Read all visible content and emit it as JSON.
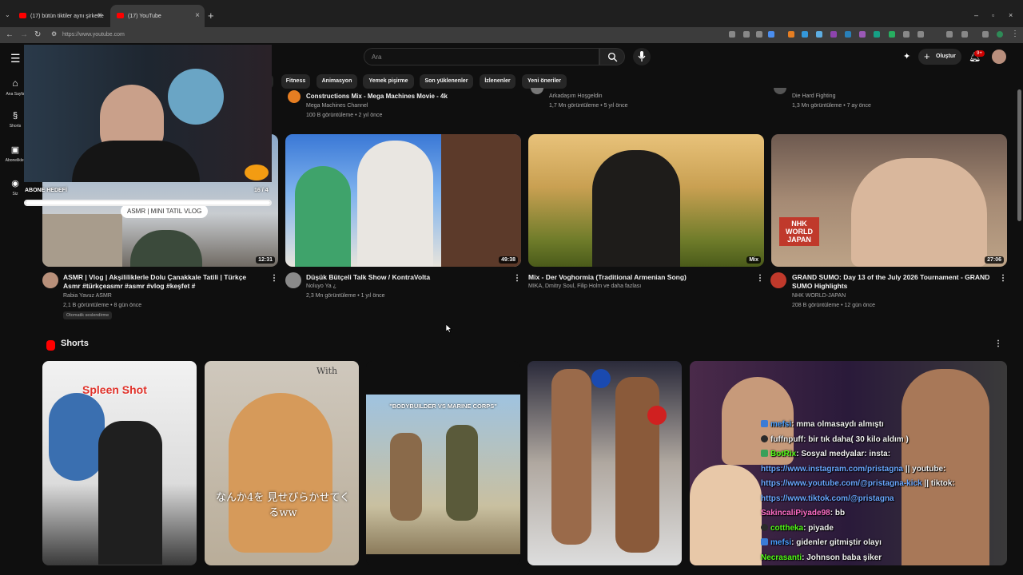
{
  "browser": {
    "tabs": [
      {
        "title": "(17) bütün tiktiler aynı şirkette"
      },
      {
        "title": "(17) YouTube"
      }
    ],
    "url": "https://www.youtube.com"
  },
  "colors": {
    "accent": "#ff0000",
    "background": "#0f0f0f",
    "link": "#3ea6ff"
  },
  "youtube": {
    "search_placeholder": "Ara",
    "create_label": "Oluştur",
    "notification_count": "9+",
    "chips": [
      "Fitness",
      "Animasyon",
      "Yemek pişirme",
      "Son yüklenenler",
      "İzlenenler",
      "Yeni öneriler"
    ],
    "guide": [
      "Ana Sayfa",
      "Shorts",
      "Abonelikler",
      "Siz"
    ],
    "top_row": [
      {
        "title": "Constructions Mix - Mega Machines Movie - 4k",
        "channel": "Mega Machines Channel",
        "meta": "100 B görüntüleme • 2 yıl önce"
      },
      {
        "channel": "Arkadaşım Hoşgeldin",
        "meta": "1,7 Mn görüntüleme • 5 yıl önce"
      },
      {
        "channel": "Die Hard Fighting",
        "meta": "1,3 Mn görüntüleme • 7 ay önce"
      }
    ],
    "videos": [
      {
        "title": "ASMR | Vlog | Akşililiklerle Dolu Çanakkale Tatili | Türkçe Asmr #türkçeasmr #asmr #vlog #keşfet #",
        "channel": "Rabia Yavuz ASMR",
        "meta": "2,1 B görüntüleme • 8 gün önce",
        "duration": "12:31",
        "badge": "Otomatik seslendirme",
        "thumb_text": "ASMR | MINI TATIL VLOG"
      },
      {
        "title": "Düşük Bütçeli Talk Show / KontraVolta",
        "channel": "Noluyo Ya ¿",
        "meta": "2,3 Mn görüntüleme • 1 yıl önce",
        "duration": "49:38"
      },
      {
        "title": "Mix - Der Voghormia (Traditional Armenian Song)",
        "channel": "MIKA, Dmitry Soul, Filip Holm ve daha fazlası",
        "duration": "Mix"
      },
      {
        "title": "GRAND SUMO: Day 13 of the July 2026 Tournament - GRAND SUMO Highlights",
        "channel": "NHK WORLD-JAPAN",
        "meta": "208 B görüntüleme • 12 gün önce",
        "duration": "27:06",
        "thumb_text": "NHK WORLD JAPAN"
      }
    ],
    "shorts_title": "Shorts",
    "shorts": [
      {
        "thumb_text": "Spleen Shot"
      },
      {
        "thumb_text": "なんか4を 見せびらかせてくるww",
        "thumb_text2": "With"
      },
      {
        "thumb_text": "\"BODYBUILDER VS MARINE CORPS\""
      },
      {},
      {}
    ]
  },
  "overlay": {
    "goal_label": "ABONE HEDEFİ",
    "goal_count": "16 / 4",
    "goal_progress": 1.0,
    "chat": [
      {
        "user": "mefsi",
        "msg": ": mma olmasaydı almıştı"
      },
      {
        "user": "fuffnpuff",
        "msg": ": bir tık daha( 30 kilo aldım )"
      },
      {
        "user": "BotRix",
        "msg": ": Sosyal medyalar: insta:"
      },
      {
        "link": "https://www.instagram.com/pristagna",
        "msg": " || youtube:"
      },
      {
        "link": "https://www.youtube.com/@pristagna-kick",
        "msg": " || tiktok:"
      },
      {
        "link": "https://www.tiktok.com/@pristagna"
      },
      {
        "user": "SakincaliPiyade98",
        "msg": ": bb"
      },
      {
        "user": "cottheka",
        "msg": ": piyade"
      },
      {
        "user": "mefsi",
        "msg": ": gidenler gitmiştir olayı"
      },
      {
        "user": "Necrasanti",
        "msg": ": Johnson baba şiker"
      }
    ]
  }
}
